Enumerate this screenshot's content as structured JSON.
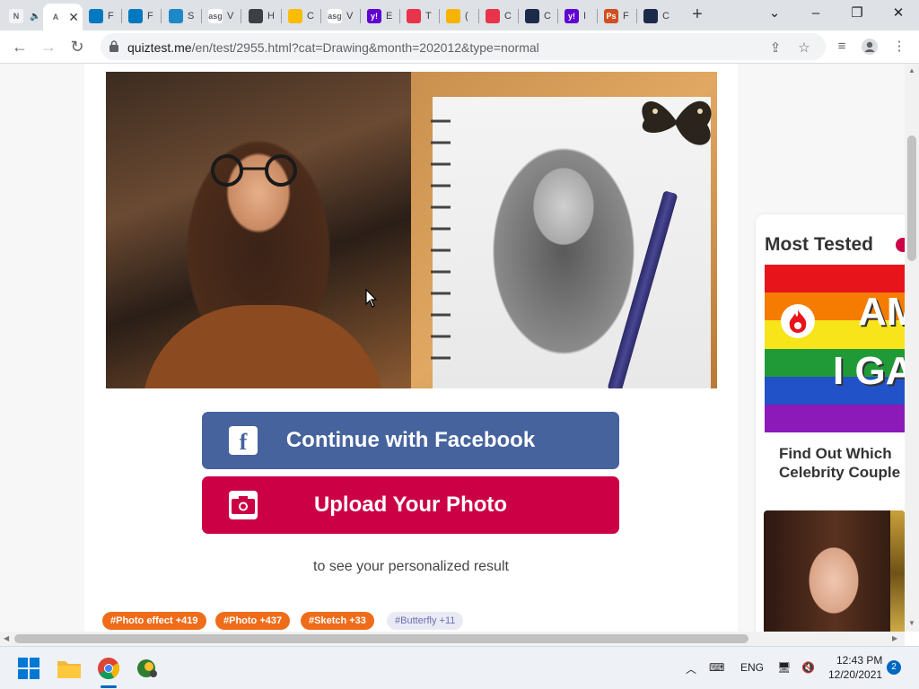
{
  "browser": {
    "tabs": [
      {
        "fav_text": "N",
        "fav_color": "#f1f3f4",
        "title": "",
        "muted_icon": true
      },
      {
        "fav_text": "A",
        "fav_color": "#ffffff",
        "title": "",
        "active": true,
        "close": "✕"
      },
      {
        "fav_text": "",
        "fav_color": "#0079c1",
        "title": "F"
      },
      {
        "fav_text": "",
        "fav_color": "#0079c1",
        "title": "F"
      },
      {
        "fav_text": "",
        "fav_color": "#1e88c7",
        "title": "S"
      },
      {
        "fav_text": "asg",
        "fav_color": "#ffffff",
        "title": "V"
      },
      {
        "fav_text": "",
        "fav_color": "#3c4043",
        "title": "H"
      },
      {
        "fav_text": "",
        "fav_color": "#fbbc04",
        "title": "C"
      },
      {
        "fav_text": "asg",
        "fav_color": "#ffffff",
        "title": "V"
      },
      {
        "fav_text": "y!",
        "fav_color": "#5f01d1",
        "title": "E"
      },
      {
        "fav_text": "",
        "fav_color": "#e8334a",
        "title": "T"
      },
      {
        "fav_text": "",
        "fav_color": "#f6b300",
        "title": "("
      },
      {
        "fav_text": "",
        "fav_color": "#e8334a",
        "title": "C"
      },
      {
        "fav_text": "",
        "fav_color": "#1c2b4a",
        "title": "C"
      },
      {
        "fav_text": "y!",
        "fav_color": "#5f01d1",
        "title": "I"
      },
      {
        "fav_text": "Ps",
        "fav_color": "#d04e1f",
        "title": "F"
      },
      {
        "fav_text": "",
        "fav_color": "#1c2b4a",
        "title": "C"
      }
    ],
    "new_tab": "+",
    "url_host": "quiztest.me",
    "url_path": "/en/test/2955.html?cat=Drawing&month=202012&type=normal"
  },
  "page": {
    "cta_facebook": "Continue with Facebook",
    "cta_upload": "Upload Your Photo",
    "result_text": "to see your personalized result",
    "tags": [
      {
        "label": "#Photo effect +419"
      },
      {
        "label": "#Photo +437"
      },
      {
        "label": "#Sketch +33"
      },
      {
        "label": "#Butterfly +11"
      }
    ],
    "sidebar": {
      "heading": "Most Tested",
      "thumb_line1": "AM",
      "thumb_line2": "I GA",
      "card_title_line1": "Find Out Which",
      "card_title_line2": "Celebrity Couple"
    }
  },
  "taskbar": {
    "lang": "ENG",
    "time": "12:43 PM",
    "date": "12/20/2021",
    "notifications": "2"
  },
  "colors": {
    "facebook_blue": "#46639e",
    "upload_red": "#cc0045",
    "tag_orange": "#ef6c1a"
  }
}
